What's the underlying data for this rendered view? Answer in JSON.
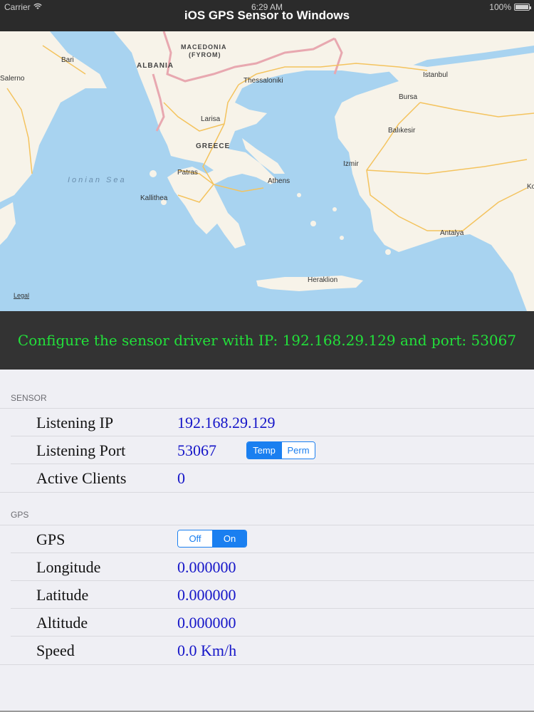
{
  "status": {
    "carrier": "Carrier",
    "time": "6:29 AM",
    "battery": "100%"
  },
  "nav": {
    "title": "iOS GPS Sensor to Windows"
  },
  "map": {
    "labels": {
      "bari": "Bari",
      "salerno": "Salerno",
      "albania": "ALBANIA",
      "macedonia1": "MACEDONIA",
      "macedonia2": "(FYROM)",
      "thessaloniki": "Thessaloniki",
      "istanbul": "Istanbul",
      "bursa": "Bursa",
      "larisa": "Larisa",
      "balikesir": "Balıkesir",
      "greece": "GREECE",
      "ionian": "Ionian Sea",
      "izmir": "Izmir",
      "patras": "Patras",
      "athens": "Athens",
      "kallithea": "Kallithea",
      "ko": "Ko",
      "antalya": "Antalya",
      "heraklion": "Heraklion"
    },
    "legal": "Legal",
    "colors": {
      "sea": "#a8d3f0",
      "land": "#f7f3e9",
      "road": "#f4c35e",
      "border": "#e8a8b0"
    }
  },
  "banner": {
    "text": "Configure the sensor driver with IP: 192.168.29.129 and port: 53067",
    "color": "#22e03a"
  },
  "sensor": {
    "header": "SENSOR",
    "rows": [
      {
        "label": "Listening IP",
        "value": "192.168.29.129"
      },
      {
        "label": "Listening Port",
        "value": "53067"
      },
      {
        "label": "Active Clients",
        "value": "0"
      }
    ],
    "port_mode": {
      "options": [
        "Temp",
        "Perm"
      ],
      "selected": "Temp"
    }
  },
  "gps": {
    "header": "GPS",
    "toggle_label": "GPS",
    "toggle": {
      "options": [
        "Off",
        "On"
      ],
      "selected": "On"
    },
    "rows": [
      {
        "label": "Longitude",
        "value": "0.000000"
      },
      {
        "label": "Latitude",
        "value": "0.000000"
      },
      {
        "label": "Altitude",
        "value": "0.000000"
      },
      {
        "label": "Speed",
        "value": "0.0 Km/h"
      }
    ]
  }
}
